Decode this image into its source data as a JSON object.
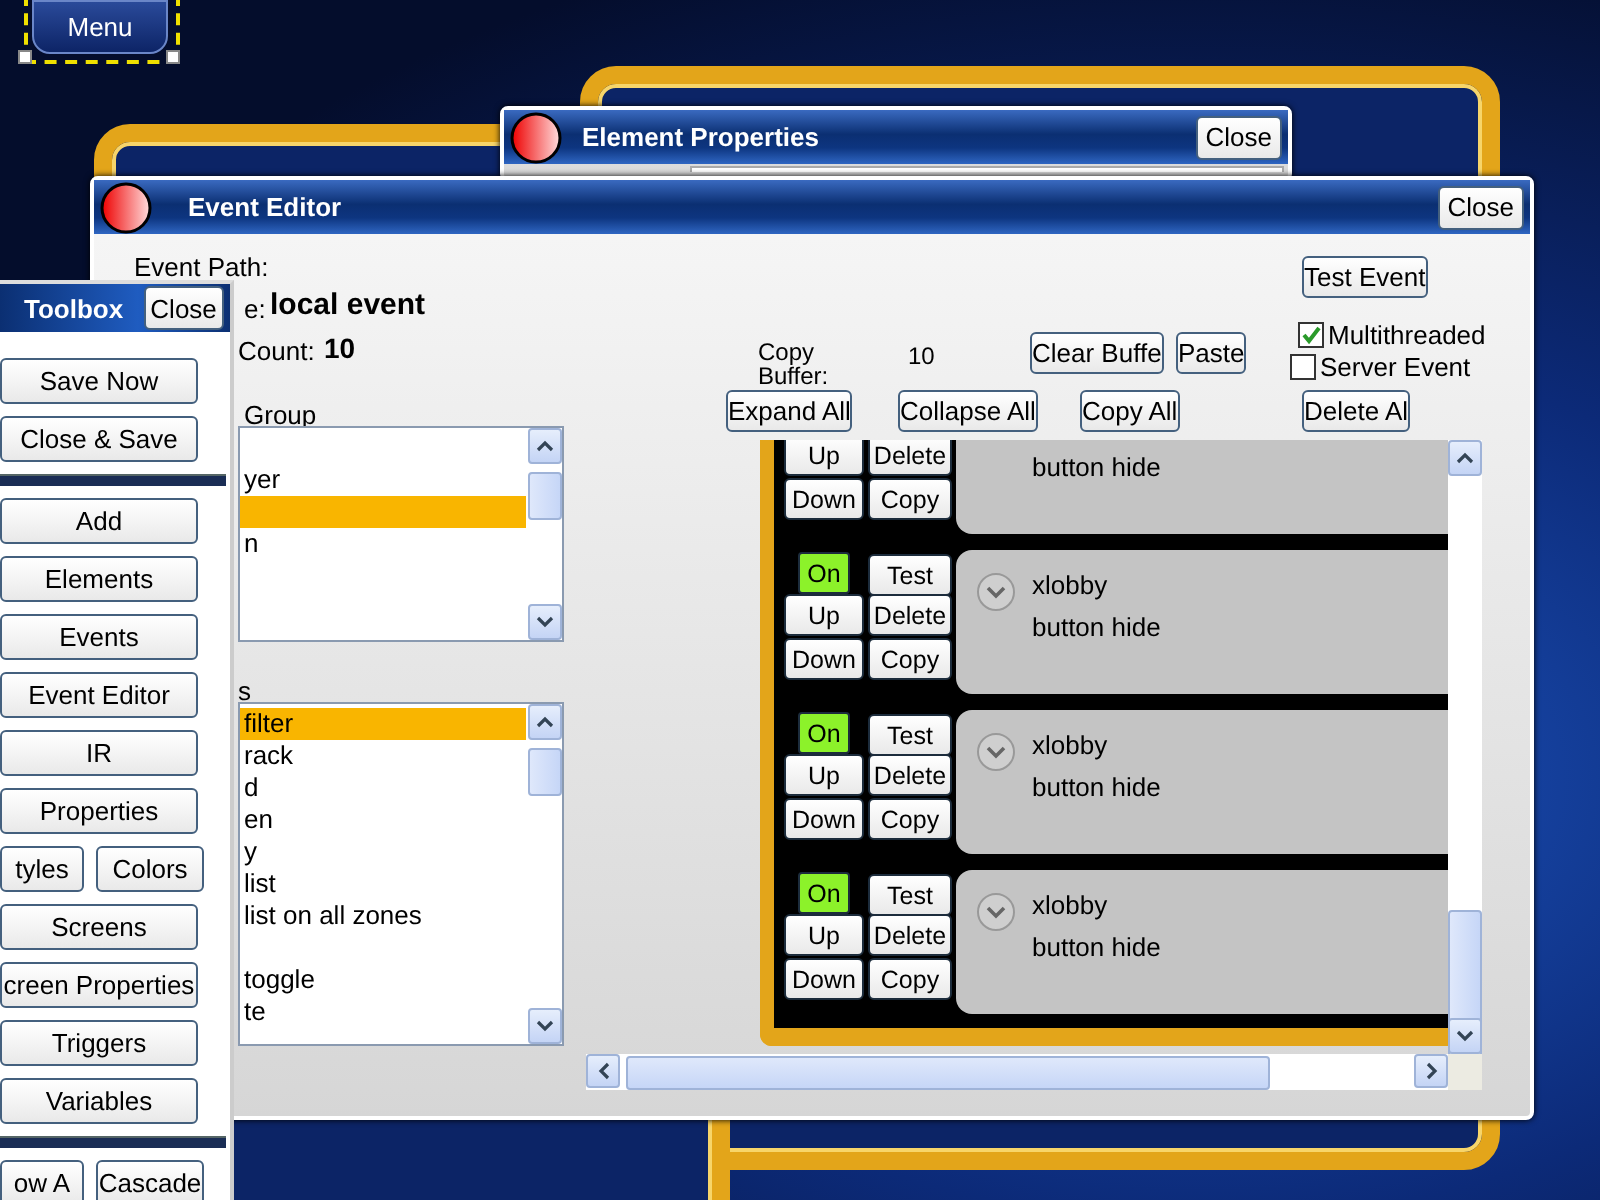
{
  "menu_button": {
    "label": "Menu",
    "selected": true
  },
  "element_properties": {
    "title": "Element Properties",
    "close": "Close"
  },
  "event_editor": {
    "title": "Event Editor",
    "close": "Close",
    "event_path_label": "Event Path:",
    "name_label": "e:",
    "name_value": "local event",
    "count_label": "Count:",
    "count_value": "10",
    "group_label": "Group",
    "group_list": [
      {
        "selected": false
      },
      {
        "text": "yer",
        "selected": false
      },
      {
        "selected": true
      },
      {
        "text": "n",
        "selected": false
      }
    ],
    "actions_label": "s",
    "actions_list": [
      {
        "text": "filter",
        "selected": true
      },
      {
        "text": "rack",
        "selected": false
      },
      {
        "text": "d",
        "selected": false
      },
      {
        "text": "en",
        "selected": false
      },
      {
        "text": "y",
        "selected": false
      },
      {
        "text": "list",
        "selected": false
      },
      {
        "text": "list on all zones",
        "selected": false
      },
      {
        "selected": false
      },
      {
        "text": "toggle",
        "selected": false
      },
      {
        "text": "te",
        "selected": false
      }
    ],
    "copy_buffer_label": "Copy Buffer:",
    "copy_buffer_value": "10",
    "clear_buffer": "Clear Buffe",
    "paste": "Paste",
    "test_event": "Test Event",
    "multithreaded": {
      "label": "Multithreaded",
      "checked": true
    },
    "server_event": {
      "label": "Server Event",
      "checked": false
    },
    "expand_all": "Expand All",
    "collapse_all": "Collapse All",
    "copy_all": "Copy All",
    "delete_all": "Delete Al",
    "events": [
      {
        "up": "Up",
        "delete": "Delete",
        "down": "Down",
        "copy": "Copy",
        "action": "button hide"
      },
      {
        "on": "On",
        "enabled": true,
        "test": "Test",
        "up": "Up",
        "delete": "Delete",
        "down": "Down",
        "copy": "Copy",
        "name": "xlobby",
        "action": "button hide"
      },
      {
        "on": "On",
        "enabled": true,
        "test": "Test",
        "up": "Up",
        "delete": "Delete",
        "down": "Down",
        "copy": "Copy",
        "name": "xlobby",
        "action": "button hide"
      },
      {
        "on": "On",
        "enabled": true,
        "test": "Test",
        "up": "Up",
        "delete": "Delete",
        "down": "Down",
        "copy": "Copy",
        "name": "xlobby",
        "action": "button hide"
      }
    ]
  },
  "toolbox": {
    "title": "Toolbox",
    "close": "Close",
    "items": [
      {
        "kind": "button",
        "label": "Save Now"
      },
      {
        "kind": "button",
        "label": "Close & Save"
      },
      {
        "kind": "divider"
      },
      {
        "kind": "button",
        "label": "Add"
      },
      {
        "kind": "button",
        "label": "Elements"
      },
      {
        "kind": "button",
        "label": "Events"
      },
      {
        "kind": "button",
        "label": "Event Editor"
      },
      {
        "kind": "button",
        "label": "IR"
      },
      {
        "kind": "button",
        "label": "Properties"
      },
      {
        "kind": "pair",
        "labels": [
          "tyles",
          "Colors"
        ]
      },
      {
        "kind": "button",
        "label": "Screens"
      },
      {
        "kind": "button",
        "label": "creen Properties"
      },
      {
        "kind": "button",
        "label": "Triggers"
      },
      {
        "kind": "button",
        "label": "Variables"
      },
      {
        "kind": "divider"
      },
      {
        "kind": "pair",
        "labels": [
          "ow A",
          "Cascade"
        ]
      }
    ]
  }
}
